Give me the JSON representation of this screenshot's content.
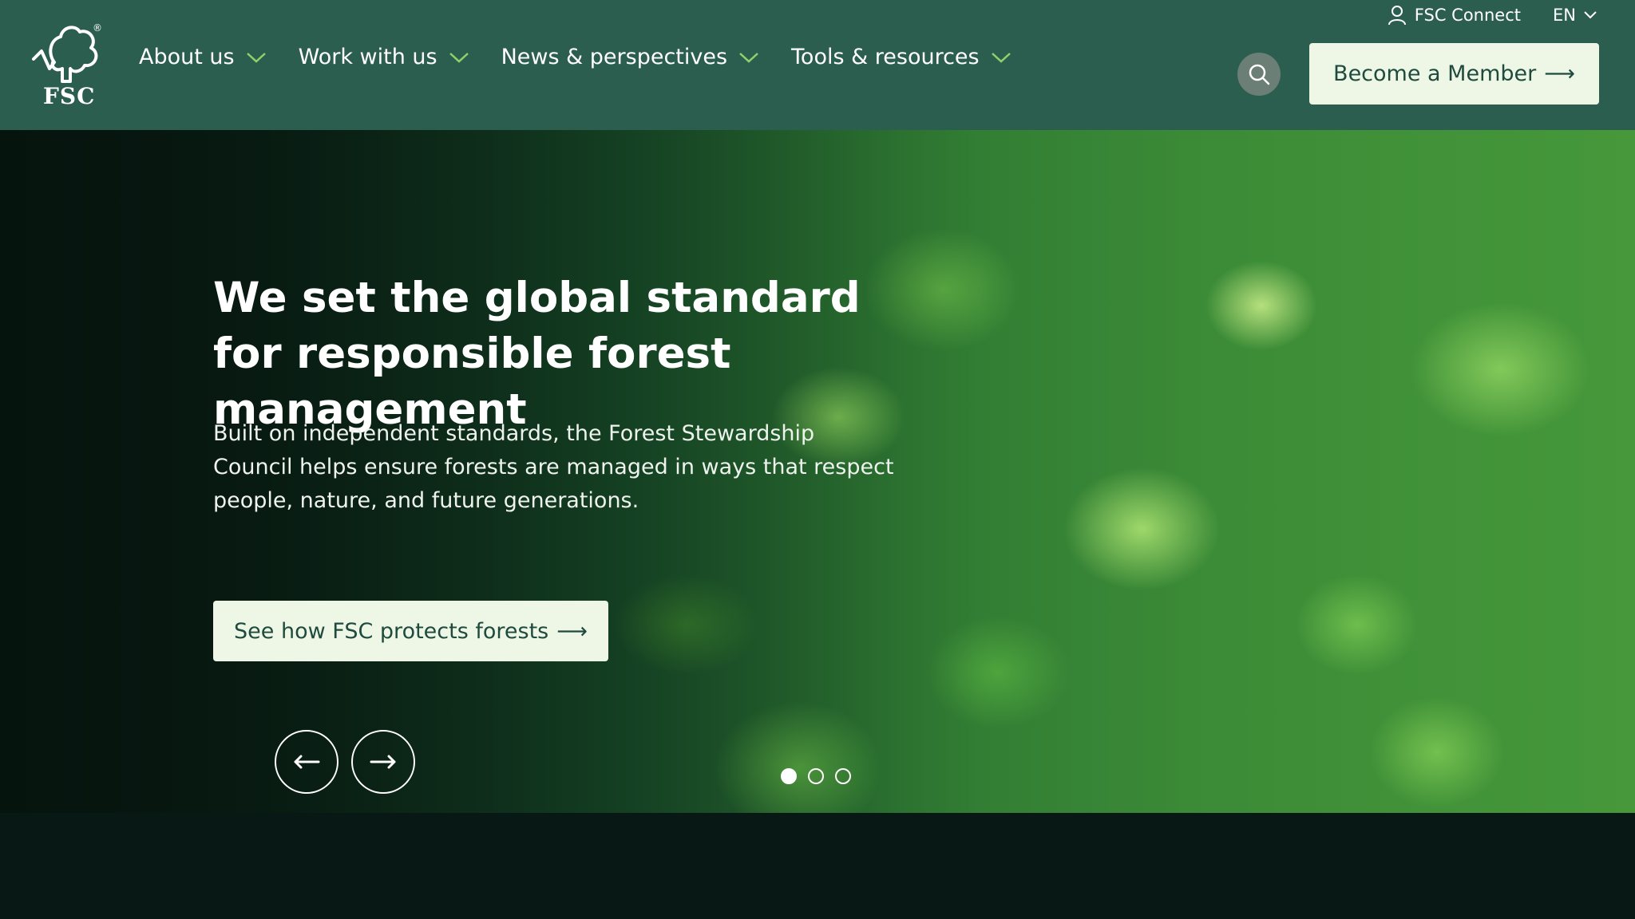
{
  "brand": {
    "logo_text": "FSC",
    "registered": "®"
  },
  "nav": {
    "items": [
      {
        "label": "About us"
      },
      {
        "label": "Work with us"
      },
      {
        "label": "News & perspectives"
      },
      {
        "label": "Tools & resources"
      }
    ]
  },
  "utility": {
    "connect_label": "FSC Connect",
    "language": "EN"
  },
  "header": {
    "member_label": "Become a Member",
    "arrow": "⟶"
  },
  "hero": {
    "title": "We set the global standard for responsible forest management",
    "body": "Built on independent standards, the Forest Stewardship Council helps ensure forests are managed in ways that respect people, nature, and future generations.",
    "cta_label": "See how FSC protects forests",
    "cta_arrow": "⟶",
    "slides_total": 3,
    "active_slide": 1
  },
  "colors": {
    "header_bg": "#2b5e4e",
    "button_bg": "#eef7e6",
    "button_text": "#1f4a3e",
    "page_bg": "#081814"
  },
  "icons": [
    "fsc-tree-logo-icon",
    "chevron-down-icon",
    "user-icon",
    "search-icon",
    "arrow-left-icon",
    "arrow-right-icon"
  ]
}
